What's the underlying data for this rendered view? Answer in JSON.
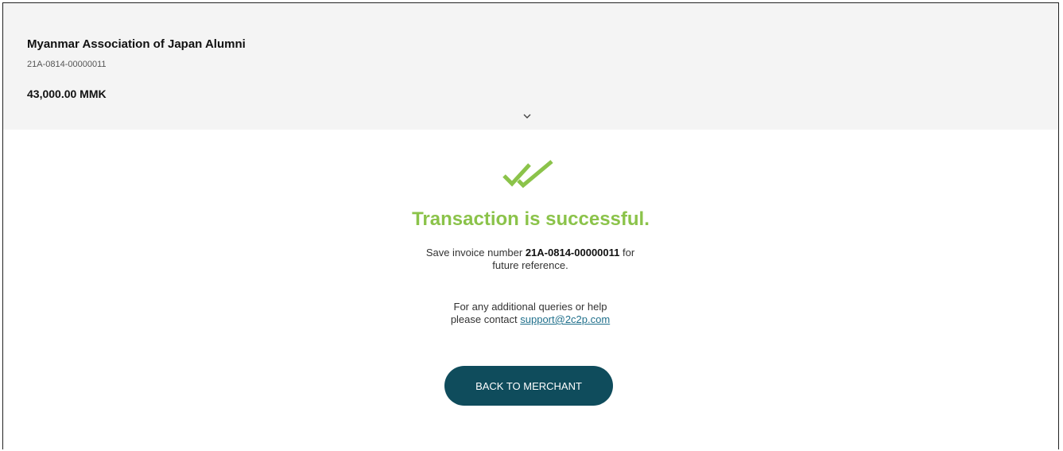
{
  "summary": {
    "merchant_name": "Myanmar Association of Japan Alumni",
    "invoice_number": "21A-0814-00000011",
    "amount": "43,000.00 MMK",
    "expand_icon": "chevron-down-icon"
  },
  "result": {
    "icon": "double-check-icon",
    "title": "Transaction is successful.",
    "save_prefix": "Save invoice number ",
    "save_invoice": "21A-0814-00000011",
    "save_suffix": " for",
    "save_line2": "future reference.",
    "help_line1": "For any additional queries or help",
    "help_prefix": "please contact ",
    "support_email": "support@2c2p.com",
    "accent_color": "#8bc34a"
  },
  "actions": {
    "back_label": "BACK TO MERCHANT",
    "button_color": "#0f4c5c"
  }
}
